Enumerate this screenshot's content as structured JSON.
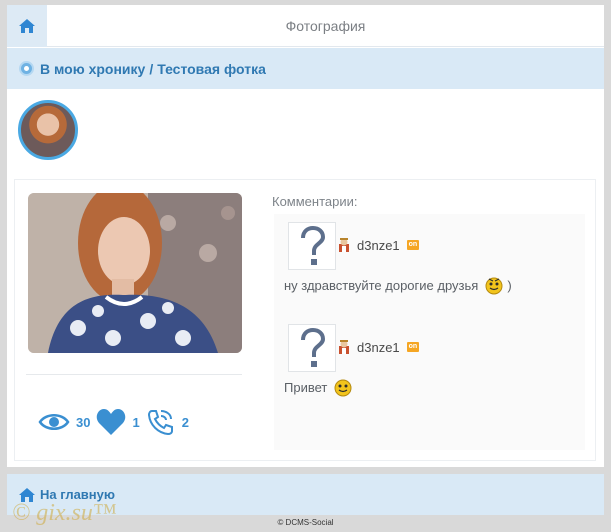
{
  "header": {
    "title": "Фотография",
    "home_icon": "home-icon"
  },
  "breadcrumb": {
    "link1": "В мою хронику",
    "separator": "/",
    "link2": "Тестовая фотка"
  },
  "stats": {
    "views": "30",
    "likes": "1",
    "comments": "2"
  },
  "comments": {
    "label": "Комментарии:",
    "items": [
      {
        "author": "d3nze1",
        "status": "on",
        "text": "ну здравствуйте дорогие друзья",
        "suffix": ")"
      },
      {
        "author": "d3nze1",
        "status": "on",
        "text": "Привет",
        "suffix": ""
      }
    ]
  },
  "footer": {
    "home_link": "На главную",
    "copyright": "© DCMS-Social"
  },
  "watermark": "© gix.su™",
  "colors": {
    "accent": "#3a8fd1",
    "panel_bg": "#d9e9f6",
    "badge": "#f5a623"
  }
}
